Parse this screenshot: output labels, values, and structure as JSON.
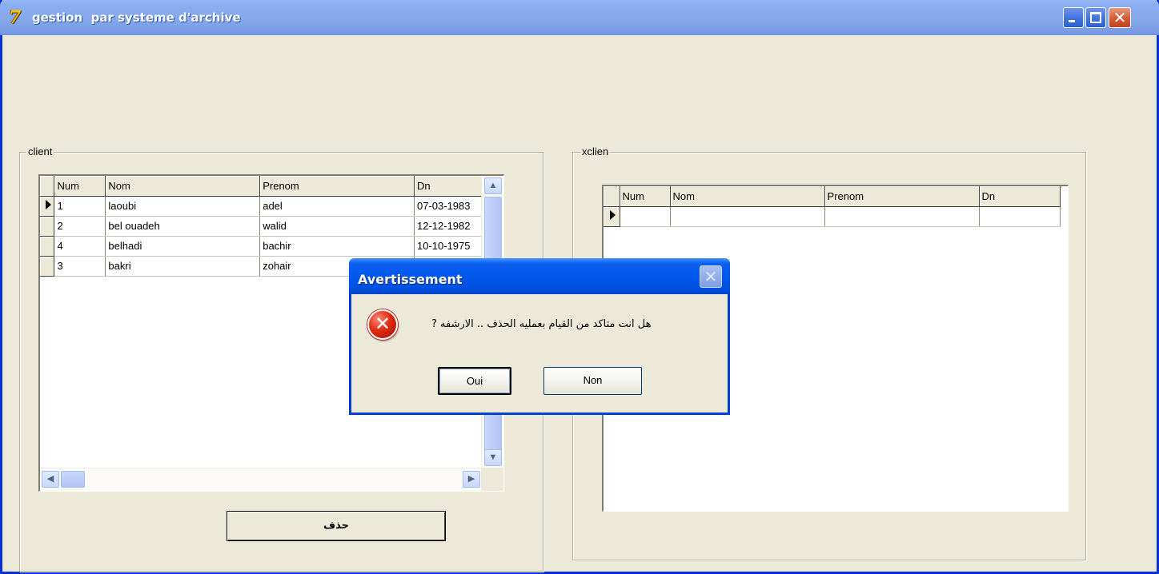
{
  "window": {
    "title": "gestion  par systeme d'archive",
    "app_icon_glyph": "7",
    "minimize": "minimize",
    "maximize": "maximize",
    "close": "✕"
  },
  "client": {
    "group_label": "client",
    "columns": [
      "Num",
      "Nom",
      "Prenom",
      "Dn"
    ],
    "rows": [
      {
        "num": "1",
        "nom": "laoubi",
        "prenom": "adel",
        "dn": "07-03-1983"
      },
      {
        "num": "2",
        "nom": "bel ouadeh",
        "prenom": "walid",
        "dn": "12-12-1982"
      },
      {
        "num": "4",
        "nom": "belhadi",
        "prenom": "bachir",
        "dn": "10-10-1975"
      },
      {
        "num": "3",
        "nom": "bakri",
        "prenom": "zohair",
        "dn": ""
      }
    ],
    "delete_label": "حذف"
  },
  "xclient": {
    "group_label": "xclien",
    "columns": [
      "Num",
      "Nom",
      "Prenom",
      "Dn"
    ],
    "rows": [
      {
        "num": "",
        "nom": "",
        "prenom": "",
        "dn": ""
      }
    ]
  },
  "dialog": {
    "title": "Avertissement",
    "close_glyph": "✕",
    "message": "? هل انت متاكد من القيام بعمليه الحذف .. الارشفه",
    "icon_glyph": "✕",
    "yes_label": "Oui",
    "no_label": "Non"
  },
  "icons": {
    "app": "app-icon",
    "error": "error-icon",
    "row_pointer": "row-pointer-icon",
    "scroll_up": "▲",
    "scroll_down": "▼",
    "scroll_left": "◀",
    "scroll_right": "▶"
  },
  "colors": {
    "titlebar": "#7a9de6",
    "dialog_titlebar": "#0058ee",
    "face": "#ece9d8",
    "error_red": "#e02a10"
  }
}
